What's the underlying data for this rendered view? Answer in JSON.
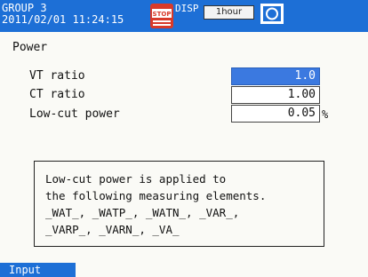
{
  "header": {
    "group": "GROUP 3",
    "datetime": "2011/02/01 11:24:15",
    "stop_icon_name": "stop-indicator-icon",
    "stop_icon_text": "STOP",
    "disp_label": "DISP",
    "interval": "1hour",
    "monitor_icon_name": "display-monitor-icon"
  },
  "section": {
    "title": "Power"
  },
  "rows": [
    {
      "label": "VT ratio",
      "value": "1.0",
      "unit": ""
    },
    {
      "label": "CT ratio",
      "value": "1.00",
      "unit": ""
    },
    {
      "label": "Low-cut power",
      "value": "0.05",
      "unit": "%"
    }
  ],
  "note": {
    "lines": [
      "Low-cut power is applied to",
      "the following measuring elements.",
      "_WAT_, _WATP_, _WATN_, _VAR_,",
      "_VARP_, _VARN_, _VA_"
    ]
  },
  "softkeys": [
    {
      "label": "Input"
    }
  ],
  "colors": {
    "header_bg": "#1d6fd6",
    "selected_field": "#3b79e0",
    "stop_icon": "#d83a2a",
    "background": "#fafaf6"
  }
}
